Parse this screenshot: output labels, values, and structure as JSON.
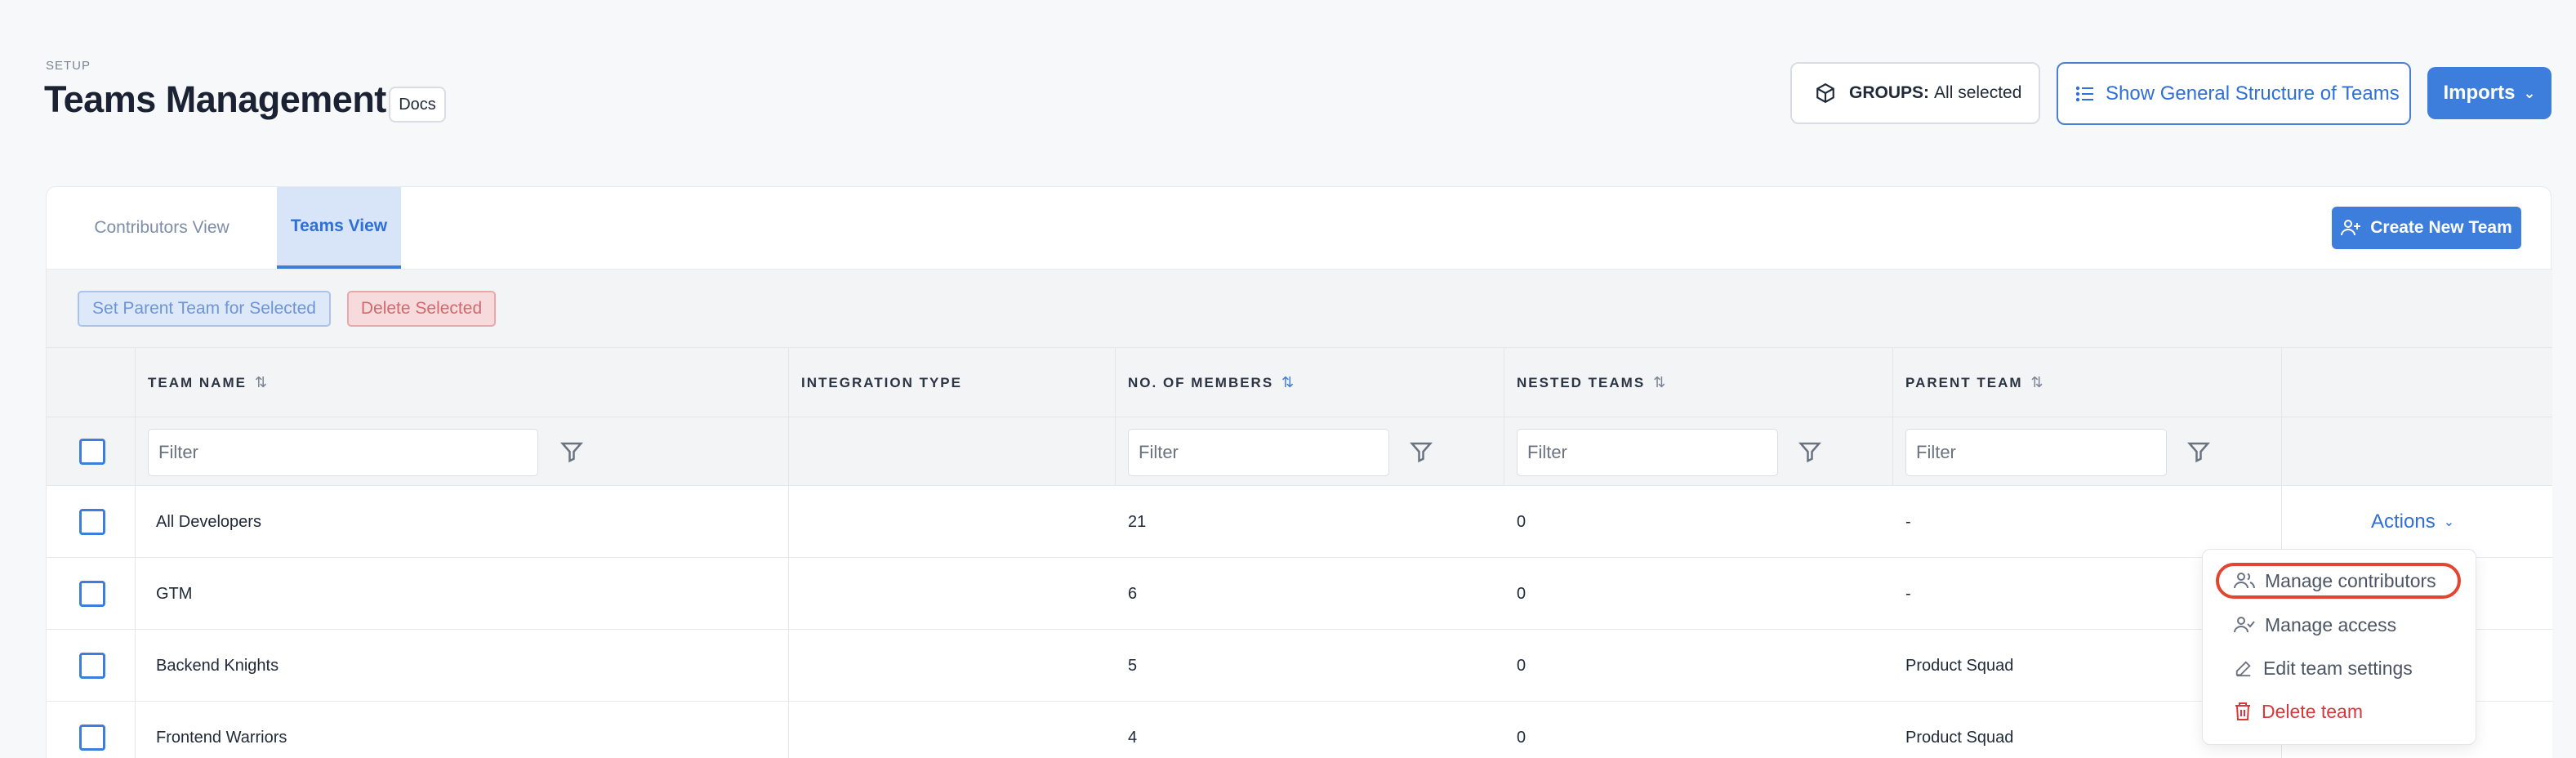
{
  "header": {
    "eyebrow": "SETUP",
    "title": "Teams Management",
    "docs_label": "Docs",
    "groups_prefix": "GROUPS:",
    "groups_value": "All selected",
    "structure_label": "Show General Structure of Teams",
    "imports_label": "Imports"
  },
  "tabs": [
    {
      "label": "Contributors View",
      "active": false
    },
    {
      "label": "Teams View",
      "active": true
    }
  ],
  "create_button_label": "Create New Team",
  "toolbar": {
    "set_parent_label": "Set Parent Team for Selected",
    "delete_label": "Delete Selected"
  },
  "table": {
    "columns": [
      {
        "label": "TEAM NAME",
        "sort": "⇅"
      },
      {
        "label": "INTEGRATION TYPE",
        "sort": ""
      },
      {
        "label": "NO. OF MEMBERS",
        "sort": "⇅"
      },
      {
        "label": "NESTED TEAMS",
        "sort": "⇅"
      },
      {
        "label": "PARENT TEAM",
        "sort": "⇅"
      }
    ],
    "filter_placeholder": "Filter",
    "rows": [
      {
        "name": "All Developers",
        "integration": "",
        "members": "21",
        "nested": "0",
        "parent": "-",
        "actions": "Actions"
      },
      {
        "name": "GTM",
        "integration": "",
        "members": "6",
        "nested": "0",
        "parent": "-",
        "actions": ""
      },
      {
        "name": "Backend Knights",
        "integration": "",
        "members": "5",
        "nested": "0",
        "parent": "Product Squad",
        "actions": ""
      },
      {
        "name": "Frontend Warriors",
        "integration": "",
        "members": "4",
        "nested": "0",
        "parent": "Product Squad",
        "actions": "Actions"
      }
    ]
  },
  "actions_menu": [
    {
      "label": "Manage contributors",
      "icon": "users-icon"
    },
    {
      "label": "Manage access",
      "icon": "user-check-icon"
    },
    {
      "label": "Edit team settings",
      "icon": "pencil-icon"
    },
    {
      "label": "Delete team",
      "icon": "trash-icon"
    }
  ],
  "colors": {
    "accent": "#3d7ddc",
    "danger": "#d9363e",
    "highlight_ring": "#e24630"
  }
}
